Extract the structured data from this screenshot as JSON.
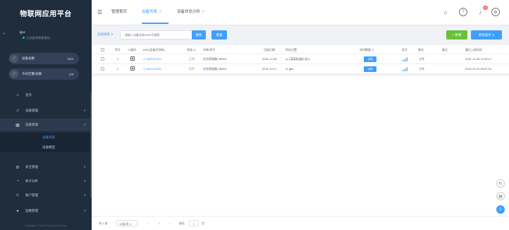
{
  "app": {
    "title": "物联网应用平台"
  },
  "user": {
    "tag": "▼",
    "name": "tjjss",
    "org": "工业园(系统管理员)"
  },
  "stats": [
    {
      "label": "设备总数",
      "count": "10/2",
      "icon": "chart-icon"
    },
    {
      "label": "今日告警/总数",
      "count": "1/9",
      "icon": "chart-icon"
    }
  ],
  "menu": {
    "home": "首页",
    "gateway": "设备管理",
    "device_group": "设备管理",
    "device_list": "设备列表",
    "device_model": "设备模型",
    "security": "安全管理",
    "stats": "统计分析",
    "account": "账户管理",
    "ops": "运维管理"
  },
  "footer": "Copyright © Smart Fire Cloud Platform",
  "tabs": [
    {
      "label": "管理首页",
      "active": false,
      "closable": false
    },
    {
      "label": "设备列表",
      "active": true,
      "closable": true
    },
    {
      "label": "设备状态分析",
      "active": false,
      "closable": true
    }
  ],
  "toolbar": {
    "filter_label": "高级搜索 ∨",
    "search_placeholder": "请输入设备名称/IMEI号搜索",
    "search_button": "搜索",
    "reset_button": "重置",
    "add_button": "+ 新增",
    "more_button": "更多操作 ∨"
  },
  "table": {
    "headers": {
      "index": "序号",
      "qr": "二维码",
      "imei": "IMEI(设备识别码)",
      "status": "状态 ◎",
      "name": "名称/型号",
      "reg_date": "注册日期",
      "location": "所在位置",
      "op": "实时数据 ⇕",
      "signal": "信号",
      "mode": "模式",
      "remark": "备注",
      "last_report": "最后上报时间"
    },
    "rows": [
      {
        "index": "1",
        "imei": "⊙ 8660313001",
        "status": "正常",
        "name": "红外探测器-TBD01",
        "reg_date": "2021-12-28",
        "location": "◎ [ 某某街道]小区A",
        "op": "详情",
        "mode": "工作",
        "remark": "",
        "last_report": "2021-12-28 13:35:17"
      },
      {
        "index": "2",
        "imei": "⊙ 86310/3306",
        "status": "报警",
        "name": "红外探测器-TBD01",
        "reg_date": "2021-10-27",
        "location": "◎ tjjss",
        "op": "详情",
        "mode": "工作",
        "remark": "",
        "last_report": "2022-01-20 09:57:31"
      }
    ]
  },
  "pager": {
    "total": "共 2 条",
    "page_size": "10条/页",
    "prev": "‹",
    "current": "1",
    "next": "›",
    "goto_label": "前往",
    "goto_value": "1",
    "page_suffix": "页"
  },
  "colors": {
    "primary": "#409eff",
    "sidebar": "#1f2d3d",
    "success": "#67c23a",
    "warning": "#e6a23c"
  }
}
